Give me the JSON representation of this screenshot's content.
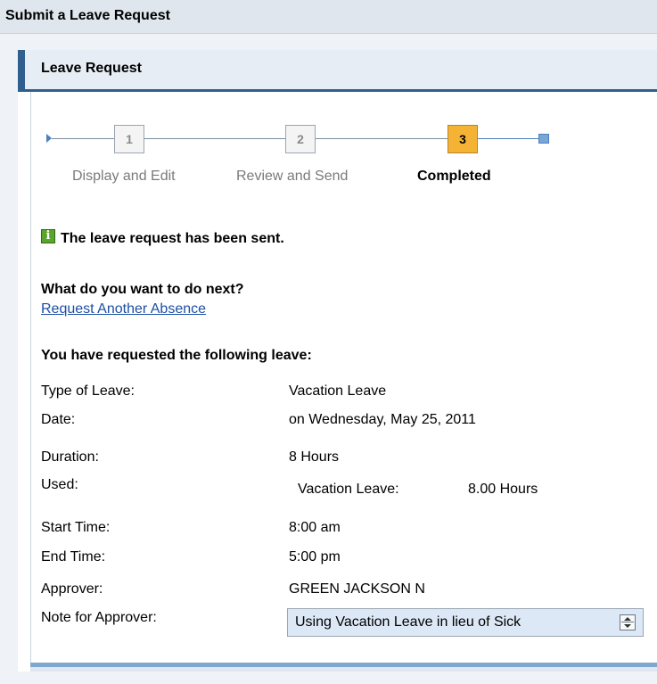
{
  "header": {
    "title": "Submit a Leave Request"
  },
  "panel": {
    "title": "Leave Request"
  },
  "roadmap": {
    "steps": [
      {
        "number": "1",
        "label": "Display and Edit",
        "state": "done"
      },
      {
        "number": "2",
        "label": "Review and Send",
        "state": "done"
      },
      {
        "number": "3",
        "label": "Completed",
        "state": "active"
      }
    ]
  },
  "message": {
    "icon": "info-icon",
    "text": "The leave request has been sent."
  },
  "next": {
    "question": "What do you want to do next?",
    "link": "Request Another Absence"
  },
  "summary": {
    "heading": "You have requested the following leave:",
    "type_label": "Type of Leave:",
    "type_value": "Vacation Leave",
    "date_label": "Date:",
    "date_value": "on Wednesday, May 25, 2011",
    "duration_label": "Duration:",
    "duration_value": "8 Hours",
    "used_label": "Used:",
    "used_type": "Vacation Leave:",
    "used_amount": "8.00 Hours",
    "start_label": "Start Time:",
    "start_value": "8:00 am",
    "end_label": "End Time:",
    "end_value": "5:00 pm",
    "approver_label": "Approver:",
    "approver_value": "GREEN JACKSON N",
    "note_label": "Note for Approver:",
    "note_value": "Using Vacation Leave in lieu of Sick"
  },
  "colors": {
    "accent": "#2e5f8f",
    "active_step": "#f5b335",
    "success_icon": "#5aa52c",
    "link": "#1d4fa3"
  }
}
